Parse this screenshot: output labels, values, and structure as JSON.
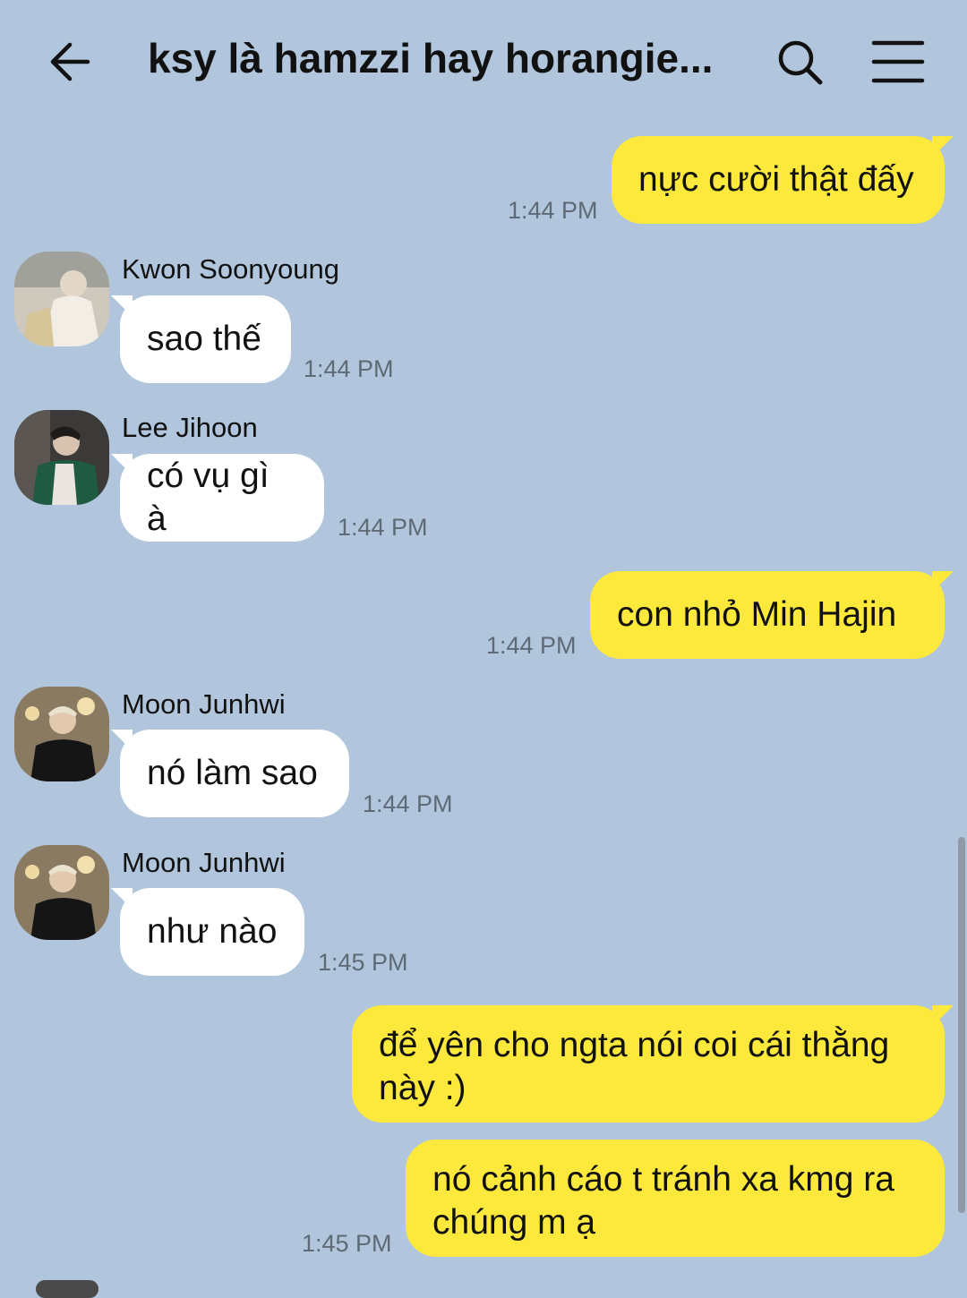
{
  "header": {
    "title": "ksy là hamzzi hay horangie...",
    "back_icon": "back-arrow-icon",
    "search_icon": "search-icon",
    "menu_icon": "hamburger-menu-icon"
  },
  "colors": {
    "background": "#b1c6dc",
    "outgoing_bubble": "#fde83c",
    "incoming_bubble": "#ffffff",
    "timestamp": "#5e6a76"
  },
  "messages": [
    {
      "direction": "out",
      "text": "nực cười thật đấy",
      "time": "1:44 PM"
    },
    {
      "direction": "in",
      "sender": "Kwon Soonyoung",
      "text": "sao thế",
      "time": "1:44 PM"
    },
    {
      "direction": "in",
      "sender": "Lee Jihoon",
      "text": "có vụ gì à",
      "time": "1:44 PM"
    },
    {
      "direction": "out",
      "text": "con nhỏ Min Hajin",
      "time": "1:44 PM"
    },
    {
      "direction": "in",
      "sender": "Moon Junhwi",
      "text": "nó làm sao",
      "time": "1:44 PM"
    },
    {
      "direction": "in",
      "sender": "Moon Junhwi",
      "text": "như nào",
      "time": "1:45 PM"
    },
    {
      "direction": "out",
      "text": "để yên cho ngta nói coi cái thằng này :)"
    },
    {
      "direction": "out",
      "text": "nó cảnh cáo t tránh xa kmg ra chúng m ạ",
      "time": "1:45 PM"
    }
  ]
}
